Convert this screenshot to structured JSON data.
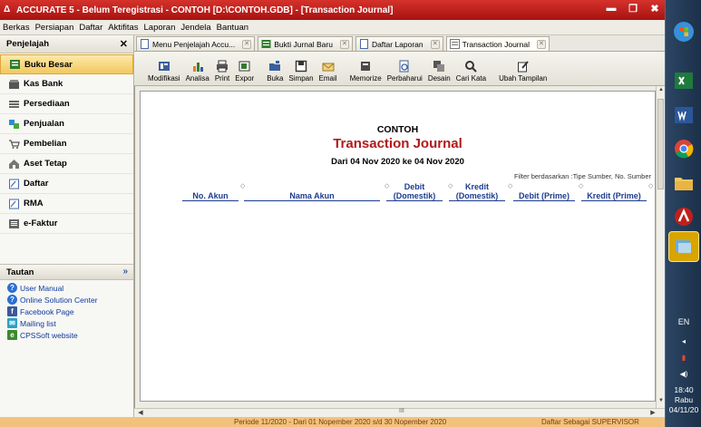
{
  "window": {
    "title": "ACCURATE 5 - Belum Teregistrasi - CONTOH  [D:\\CONTOH.GDB] - [Transaction Journal]"
  },
  "menubar": {
    "items": [
      "Berkas",
      "Persiapan",
      "Daftar",
      "Aktifitas",
      "Laporan",
      "Jendela",
      "Bantuan"
    ]
  },
  "sidebar": {
    "title": "Penjelajah",
    "items": [
      {
        "label": "Buku Besar",
        "icon": "ledger-icon",
        "active": true
      },
      {
        "label": "Kas Bank",
        "icon": "cash-bank-icon"
      },
      {
        "label": "Persediaan",
        "icon": "inventory-icon"
      },
      {
        "label": "Penjualan",
        "icon": "sales-icon"
      },
      {
        "label": "Pembelian",
        "icon": "cart-icon"
      },
      {
        "label": "Aset Tetap",
        "icon": "house-icon"
      },
      {
        "label": "Daftar",
        "icon": "list-icon"
      },
      {
        "label": "RMA",
        "icon": "rma-icon"
      },
      {
        "label": "e-Faktur",
        "icon": "efaktur-icon"
      }
    ],
    "tautan_title": "Tautan",
    "links": [
      {
        "label": "User Manual",
        "icon": "help-icon",
        "color": "#2a6fd1"
      },
      {
        "label": "Online Solution Center",
        "icon": "help-icon",
        "color": "#2a6fd1"
      },
      {
        "label": "Facebook Page",
        "icon": "facebook-icon",
        "color": "#3b5998"
      },
      {
        "label": "Mailing list",
        "icon": "mailing-icon",
        "color": "#2aa0c8"
      },
      {
        "label": "CPSSoft website",
        "icon": "website-icon",
        "color": "#3c8a2e"
      }
    ]
  },
  "tabs": [
    {
      "label": "Menu Penjelajah Accu...",
      "active": false
    },
    {
      "label": "Bukti Jurnal Baru",
      "active": false
    },
    {
      "label": "Daftar Laporan",
      "active": false
    },
    {
      "label": "Transaction Journal",
      "active": true
    }
  ],
  "toolbar": {
    "tools": [
      "Modifikasi",
      "Analisa",
      "Print",
      "Expor",
      "Buka",
      "Simpan",
      "Email",
      "Memorize",
      "Perbaharui",
      "Desain",
      "Cari Kata",
      "Ubah Tampilan"
    ]
  },
  "report": {
    "company": "CONTOH",
    "title": "Transaction Journal",
    "range": "Dari 04 Nov 2020 ke 04 Nov 2020",
    "filter_note": "Filter berdasarkan :Tipe Sumber, No. Sumber",
    "columns": {
      "no_akun": "No. Akun",
      "nama_akun": "Nama Akun",
      "debit_dom_1": "Debit",
      "debit_dom_2": "(Domestik)",
      "kredit_dom_1": "Kredit",
      "kredit_dom_2": "(Domestik)",
      "debit_prime": "Debit (Prime)",
      "kredit_prime": "Kredit (Prime)"
    }
  },
  "scroll": {
    "h_grip": "III"
  },
  "status": {
    "period": "Periode 11/2020 - Dari 01 Nopember 2020 s/d 30 Nopember 2020",
    "user": "Daftar Sebagai SUPERVISOR"
  },
  "taskbar": {
    "lang": "EN",
    "time": "18:40",
    "day": "Rabu",
    "date": "04/11/20"
  },
  "colors": {
    "title_bar": "#c0201b",
    "report_title": "#b11a1a",
    "column_header": "#1d3c8e",
    "status_bar": "#f2c27c"
  }
}
